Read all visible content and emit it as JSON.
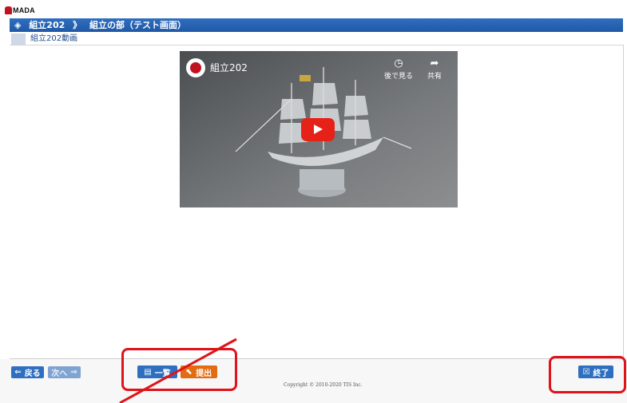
{
  "header": {
    "logo_text": "MADA"
  },
  "titlebar": {
    "crumb1": "組立202",
    "crumb2": "組立の部（テスト画面）"
  },
  "subtitle": {
    "label": "組立202動画"
  },
  "video": {
    "title": "組立202",
    "watch_later": "後で見る",
    "share": "共有",
    "icons": [
      "clock-icon",
      "share-arrow-icon",
      "play-icon"
    ]
  },
  "footer": {
    "back_label": "戻る",
    "next_label": "次へ",
    "list_label": "一覧",
    "submit_label": "提出",
    "end_label": "終了",
    "copyright": "Copyright © 2010-2020 TIS Inc."
  },
  "colors": {
    "accent": "#1f58a5",
    "submit": "#e36b12",
    "annotation": "#e0131a",
    "youtube_red": "#e62117"
  }
}
